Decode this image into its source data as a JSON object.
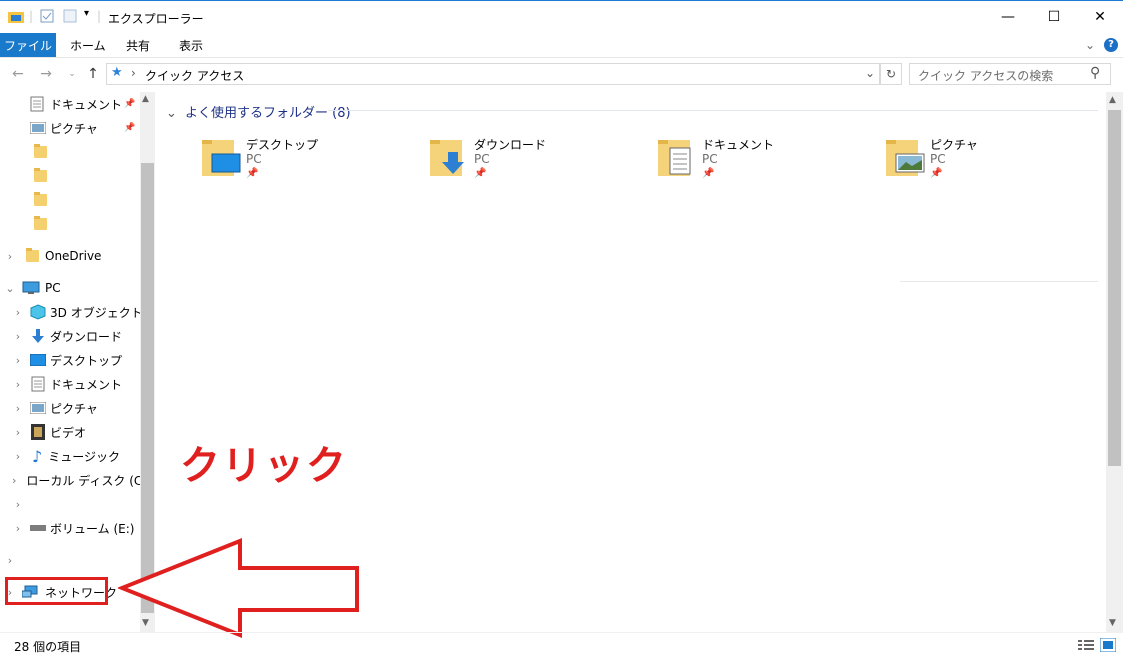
{
  "window": {
    "title": "エクスプローラー",
    "minimize": "—",
    "maximize": "☐",
    "close": "✕"
  },
  "ribbon": {
    "tabs": [
      "ファイル",
      "ホーム",
      "共有",
      "表示"
    ],
    "help": "?",
    "collapse": "⌄"
  },
  "address": {
    "path": "クイック アクセス",
    "separator": "›",
    "dropdown": "⌄",
    "refresh": "↻"
  },
  "search": {
    "placeholder": "クイック アクセスの検索",
    "icon": "⚲"
  },
  "sidebar": {
    "pinned": [
      {
        "label": "ドキュメント",
        "pin": "📌"
      },
      {
        "label": "ピクチャ",
        "pin": "📌"
      }
    ],
    "onedrive": "OneDrive",
    "pc": "PC",
    "pc_items": [
      "3D オブジェクト",
      "ダウンロード",
      "デスクトップ",
      "ドキュメント",
      "ピクチャ",
      "ビデオ",
      "ミュージック",
      "ローカル ディスク (C",
      "",
      "ボリューム (E:)"
    ],
    "network": "ネットワーク"
  },
  "main": {
    "section": "よく使用するフォルダー (8)",
    "folders": [
      {
        "name": "デスクトップ",
        "sub": "PC"
      },
      {
        "name": "ダウンロード",
        "sub": "PC"
      },
      {
        "name": "ドキュメント",
        "sub": "PC"
      },
      {
        "name": "ピクチャ",
        "sub": "PC"
      }
    ]
  },
  "annotation": {
    "text": "クリック",
    "color": "#e0201f"
  },
  "status": {
    "count": "28 個の項目"
  }
}
